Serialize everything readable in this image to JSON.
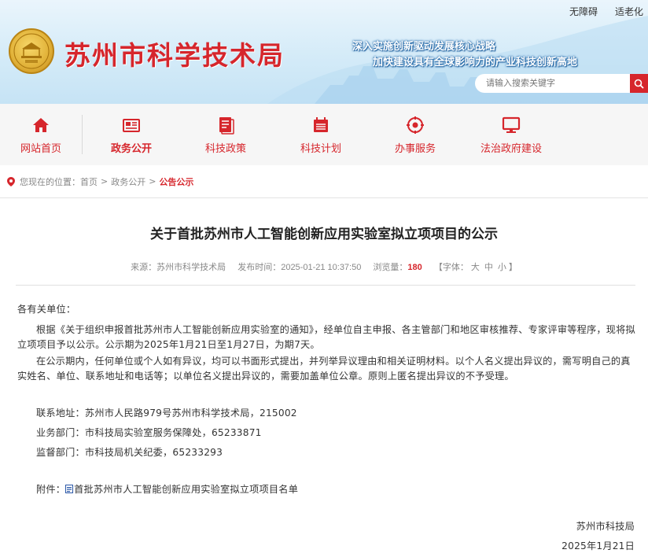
{
  "top_links": {
    "accessibility": "无障碍",
    "elderly": "适老化"
  },
  "header": {
    "site_title": "苏州市科学技术局",
    "slogan_line1": "深入实施创新驱动发展核心战略",
    "slogan_line2": "加快建设具有全球影响力的产业科技创新高地",
    "search_placeholder": "请输入搜索关键字"
  },
  "nav": {
    "items": [
      {
        "label": "网站首页",
        "icon": "home-icon"
      },
      {
        "label": "政务公开",
        "icon": "newspaper-icon"
      },
      {
        "label": "科技政策",
        "icon": "document-icon"
      },
      {
        "label": "科技计划",
        "icon": "calendar-icon"
      },
      {
        "label": "办事服务",
        "icon": "service-icon"
      },
      {
        "label": "法治政府建设",
        "icon": "monitor-icon"
      }
    ],
    "active": "政务公开"
  },
  "breadcrumb": {
    "prefix": "您现在的位置：",
    "items": [
      "首页",
      "政务公开"
    ],
    "current": "公告公示",
    "separator": ">"
  },
  "article": {
    "title": "关于首批苏州市人工智能创新应用实验室拟立项项目的公示",
    "meta": {
      "source_label": "来源：",
      "source": "苏州市科学技术局",
      "time_label": "发布时间：",
      "time": "2025-01-21 10:37:50",
      "views_label": "浏览量：",
      "views": "180",
      "font_label": "【字体：",
      "font_large": "大",
      "font_medium": "中",
      "font_small": "小",
      "font_close": "】"
    },
    "salutation": "各有关单位：",
    "paragraph1": "根据《关于组织申报首批苏州市人工智能创新应用实验室的通知》，经单位自主申报、各主管部门和地区审核推荐、专家评审等程序，现将拟立项项目予以公示。公示期为2025年1月21日至1月27日，为期7天。",
    "paragraph2": "在公示期内，任何单位或个人如有异议，均可以书面形式提出，并列举异议理由和相关证明材料。以个人名义提出异议的，需写明自己的真实姓名、单位、联系地址和电话等；以单位名义提出异议的，需要加盖单位公章。原则上匿名提出异议的不予受理。",
    "contact_address": "联系地址：苏州市人民路979号苏州市科学技术局，215002",
    "business_dept": "业务部门：市科技局实验室服务保障处，65233871",
    "supervision_dept": "监督部门：市科技局机关纪委，65233293",
    "attachment_label": "附件：",
    "attachment_name": "首批苏州市人工智能创新应用实验室拟立项项目名单",
    "signature_org": "苏州市科技局",
    "signature_date": "2025年1月21日"
  },
  "colors": {
    "brand_red": "#d6262c",
    "header_blue": "#d4ebf8"
  }
}
